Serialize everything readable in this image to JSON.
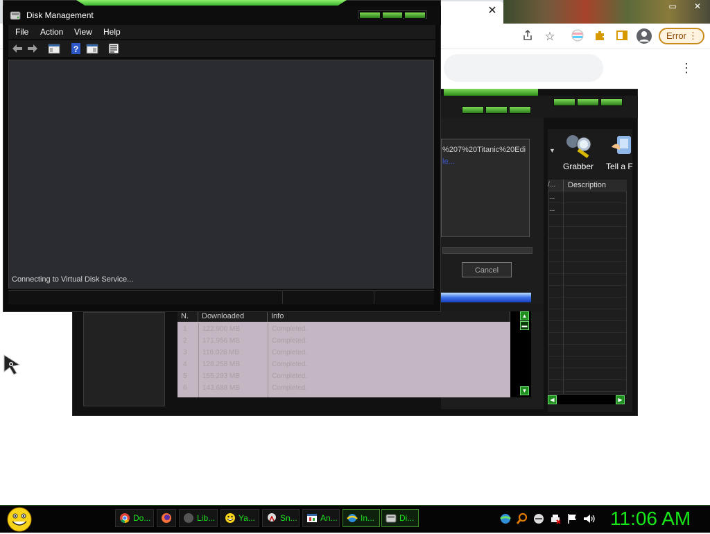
{
  "chrome": {
    "tab_close": "✕",
    "kebab": "⋮",
    "error_label": "Error",
    "error_dots": "⋮"
  },
  "downloader": {
    "url_fragment": "%207%20Titanic%20Edi",
    "link_fragment": "le...",
    "cancel_label": "Cancel",
    "tools": [
      {
        "label": "Grabber",
        "icon": "grabber-icon"
      },
      {
        "label": "Tell a F",
        "icon": "tell-a-friend-icon"
      }
    ],
    "right_table": {
      "narrow_header": "/...",
      "header": "Description",
      "rows": [
        "...",
        "..."
      ]
    },
    "table": {
      "columns": [
        "N.",
        "Downloaded",
        "Info"
      ],
      "rows": [
        {
          "n": "1",
          "downloaded": "122.900 MB",
          "info": "Completed."
        },
        {
          "n": "2",
          "downloaded": "171.956 MB",
          "info": "Completed."
        },
        {
          "n": "3",
          "downloaded": "116.028 MB",
          "info": "Completed."
        },
        {
          "n": "4",
          "downloaded": "128.258 MB",
          "info": "Completed."
        },
        {
          "n": "5",
          "downloaded": "155.293 MB",
          "info": "Completed."
        },
        {
          "n": "6",
          "downloaded": "143.688 MB",
          "info": "Completed."
        }
      ]
    }
  },
  "disk_management": {
    "title": "Disk Management",
    "menu": [
      "File",
      "Action",
      "View",
      "Help"
    ],
    "toolbar": [
      "back-arrow-icon",
      "forward-arrow-icon",
      "console-tree-icon",
      "help-icon",
      "properties-icon",
      "export-icon"
    ],
    "status": "Connecting to Virtual Disk Service..."
  },
  "taskbar": {
    "tasks": [
      {
        "label": "Do...",
        "icon": "chrome-icon",
        "active": false
      },
      {
        "label": "",
        "icon": "firefox-icon",
        "active": false
      },
      {
        "label": "Lib...",
        "icon": "libreoffice-icon",
        "active": false
      },
      {
        "label": "Ya...",
        "icon": "smiley-icon",
        "active": false
      },
      {
        "label": "Sn...",
        "icon": "snipping-tool-icon",
        "active": false
      },
      {
        "label": "An...",
        "icon": "app-window-icon",
        "active": false
      },
      {
        "label": "In...",
        "icon": "internet-icon",
        "active": true
      },
      {
        "label": "Di...",
        "icon": "disk-management-icon",
        "active": true
      }
    ],
    "tray_icons": [
      "network-globe-icon",
      "search-magnifier-icon",
      "minus-circle-icon",
      "printer-icon",
      "flag-icon",
      "monitor-icon",
      "speaker-icon"
    ],
    "clock": "11:06 AM",
    "colors": {
      "accent": "#1de31d"
    }
  }
}
